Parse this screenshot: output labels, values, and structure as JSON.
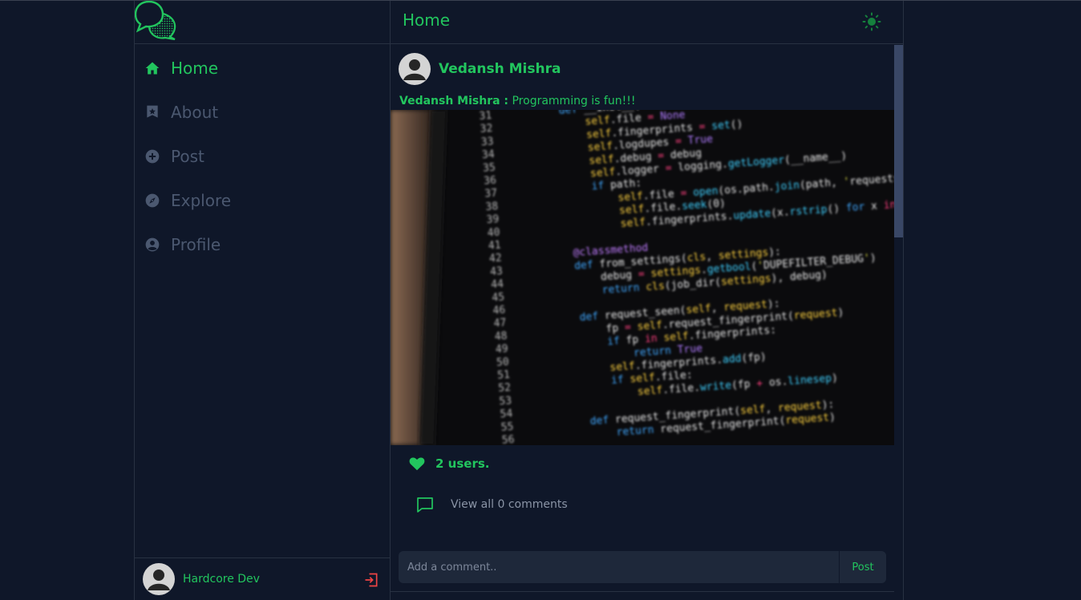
{
  "colors": {
    "accent": "#22c55e",
    "background": "#0f1729",
    "muted": "#4b5870",
    "border": "#283142",
    "input_bg": "#1e283a",
    "logout": "#ef4444"
  },
  "logo": {
    "icon": "chat-bubbles-logo"
  },
  "nav": {
    "items": [
      {
        "label": "Home",
        "icon": "home-icon",
        "active": true
      },
      {
        "label": "About",
        "icon": "star-bookmark-icon",
        "active": false
      },
      {
        "label": "Post",
        "icon": "plus-circle-icon",
        "active": false
      },
      {
        "label": "Explore",
        "icon": "compass-icon",
        "active": false
      },
      {
        "label": "Profile",
        "icon": "user-circle-icon",
        "active": false
      }
    ]
  },
  "sidebar_footer": {
    "username": "Hardcore Dev",
    "logout_icon": "logout-icon"
  },
  "header": {
    "title": "Home",
    "theme_icon": "sun-icon"
  },
  "post": {
    "author": "Vedansh Mishra",
    "caption_author": "Vedansh Mishra :",
    "caption_text": " Programming is fun!!!",
    "image_alt": "code-screenshot",
    "likes": "2 users.",
    "view_comments": "View all 0 comments",
    "comment_placeholder": "Add a comment..",
    "post_button": "Post"
  },
  "code_lines": {
    "numbers": [
      "31",
      "32",
      "33",
      "34",
      "35",
      "36",
      "37",
      "38",
      "39",
      "40",
      "41",
      "42",
      "43",
      "44",
      "45",
      "46",
      "47",
      "48",
      "49",
      "50",
      "51",
      "52",
      "53",
      "54",
      "55",
      "56"
    ],
    "lines": [
      "    def __init__(self, path=None, debug=False):",
      "        self.file = None",
      "        self.fingerprints = set()",
      "        self.logdupes = True",
      "        self.debug = debug",
      "        self.logger = logging.getLogger(__name__)",
      "        if path:",
      "            self.file = open(os.path.join(path, 'requests.seen'), 'a+')",
      "            self.file.seek(0)",
      "            self.fingerprints.update(x.rstrip() for x in self.file)",
      "",
      "    @classmethod",
      "    def from_settings(cls, settings):",
      "        debug = settings.getbool('DUPEFILTER_DEBUG')",
      "        return cls(job_dir(settings), debug)",
      "",
      "    def request_seen(self, request):",
      "        fp = self.request_fingerprint(request)",
      "        if fp in self.fingerprints:",
      "            return True",
      "        self.fingerprints.add(fp)",
      "        if self.file:",
      "            self.file.write(fp + os.linesep)",
      "",
      "    def request_fingerprint(self, request):",
      "        return request_fingerprint(request)"
    ]
  }
}
